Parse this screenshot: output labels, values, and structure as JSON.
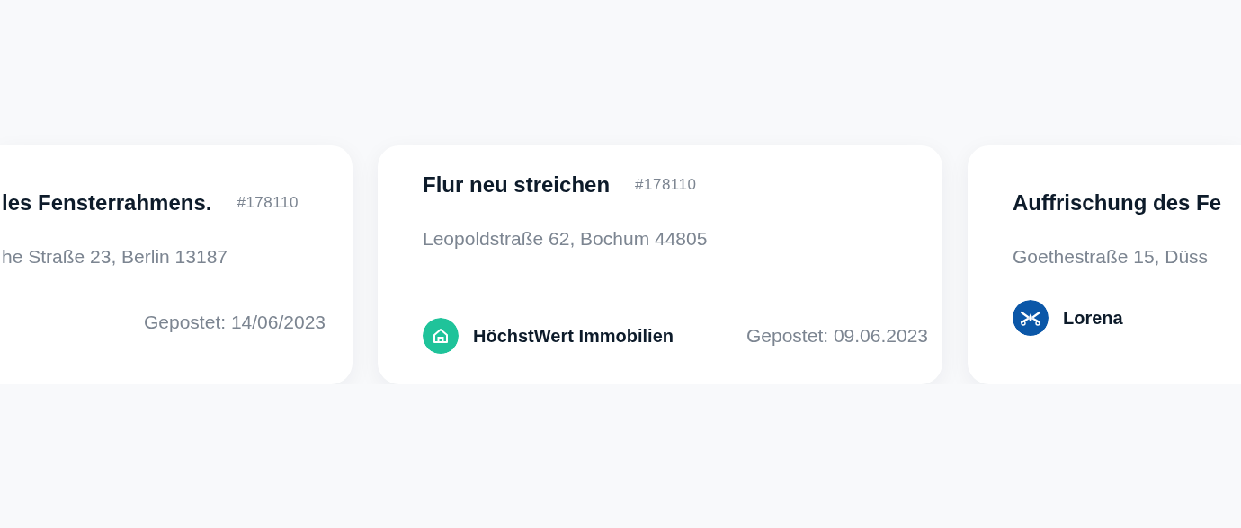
{
  "cards": [
    {
      "title": "les Fensterrahmens.",
      "number": "#178110",
      "address": "he Straße 23, Berlin 13187",
      "posted": "Gepostet: 14/06/2023"
    },
    {
      "title": "Flur neu streichen",
      "number": "#178110",
      "address": "Leopoldstraße 62, Bochum 44805",
      "company": {
        "name": "HöchstWert Immobilien",
        "color": "#1fc39a",
        "kind": "house"
      },
      "posted": "Gepostet: 09.06.2023"
    },
    {
      "title": "Auffrischung des Fe",
      "address": "Goethestraße 15, Düss",
      "company": {
        "name": "Lorena",
        "color": "#0b57a8",
        "kind": "tools"
      }
    }
  ]
}
